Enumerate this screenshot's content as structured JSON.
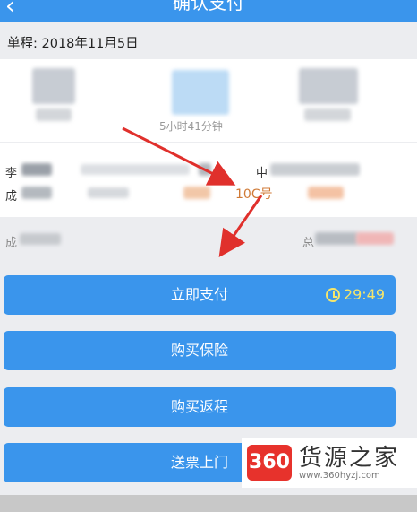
{
  "header": {
    "back_icon": "back-arrow-icon",
    "title": "确认支付"
  },
  "trip": {
    "label": "单程: 2018年11月5日"
  },
  "card1": {
    "duration": "5小时41分钟"
  },
  "card2": {
    "row1_prefix": "李",
    "row1_mid": "中",
    "row2_prefix": "成",
    "seat": "10C号"
  },
  "info_row": {
    "left": "成",
    "right": "总"
  },
  "buttons": {
    "pay_now": "立即支付",
    "timer": "29:49",
    "buy_insurance": "购买保险",
    "buy_return": "购买返程",
    "deliver_ticket": "送票上门"
  },
  "watermark": {
    "logo": "360",
    "brand": "货源之家",
    "url": "www.360hyzj.com"
  },
  "colors": {
    "primary": "#3a95ec",
    "seat": "#d07a36",
    "timer": "#f6e66a",
    "arrow": "#e0302c"
  }
}
